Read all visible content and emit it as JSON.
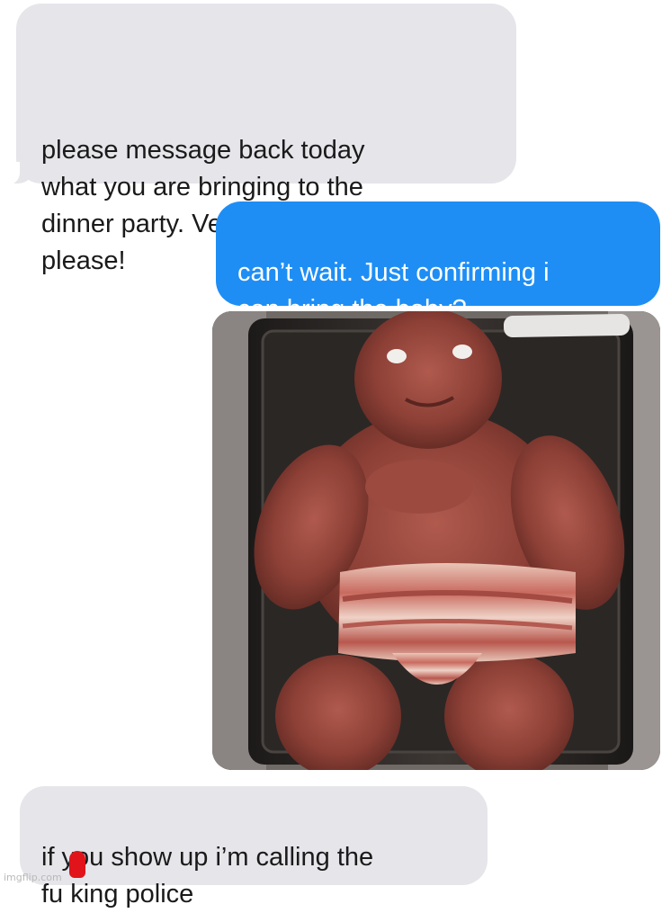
{
  "conversation": {
    "messages": [
      {
        "direction": "incoming",
        "type": "text",
        "text": "please message back today\nwhat you are bringing to the\ndinner party. Vegan dishes only\nplease!"
      },
      {
        "direction": "outgoing",
        "type": "text",
        "text": "can’t wait. Just confirming i\ncan bring the baby?"
      },
      {
        "direction": "outgoing",
        "type": "image",
        "description_icon": "photo"
      },
      {
        "direction": "incoming",
        "type": "text",
        "text": "if you show up i’m calling the\nfu  king police"
      }
    ]
  },
  "watermark": "imgflip.com",
  "colors": {
    "incoming_bubble": "#e5e5ea",
    "outgoing_bubble": "#1e8ef5",
    "censor_mark": "#e0141a"
  }
}
